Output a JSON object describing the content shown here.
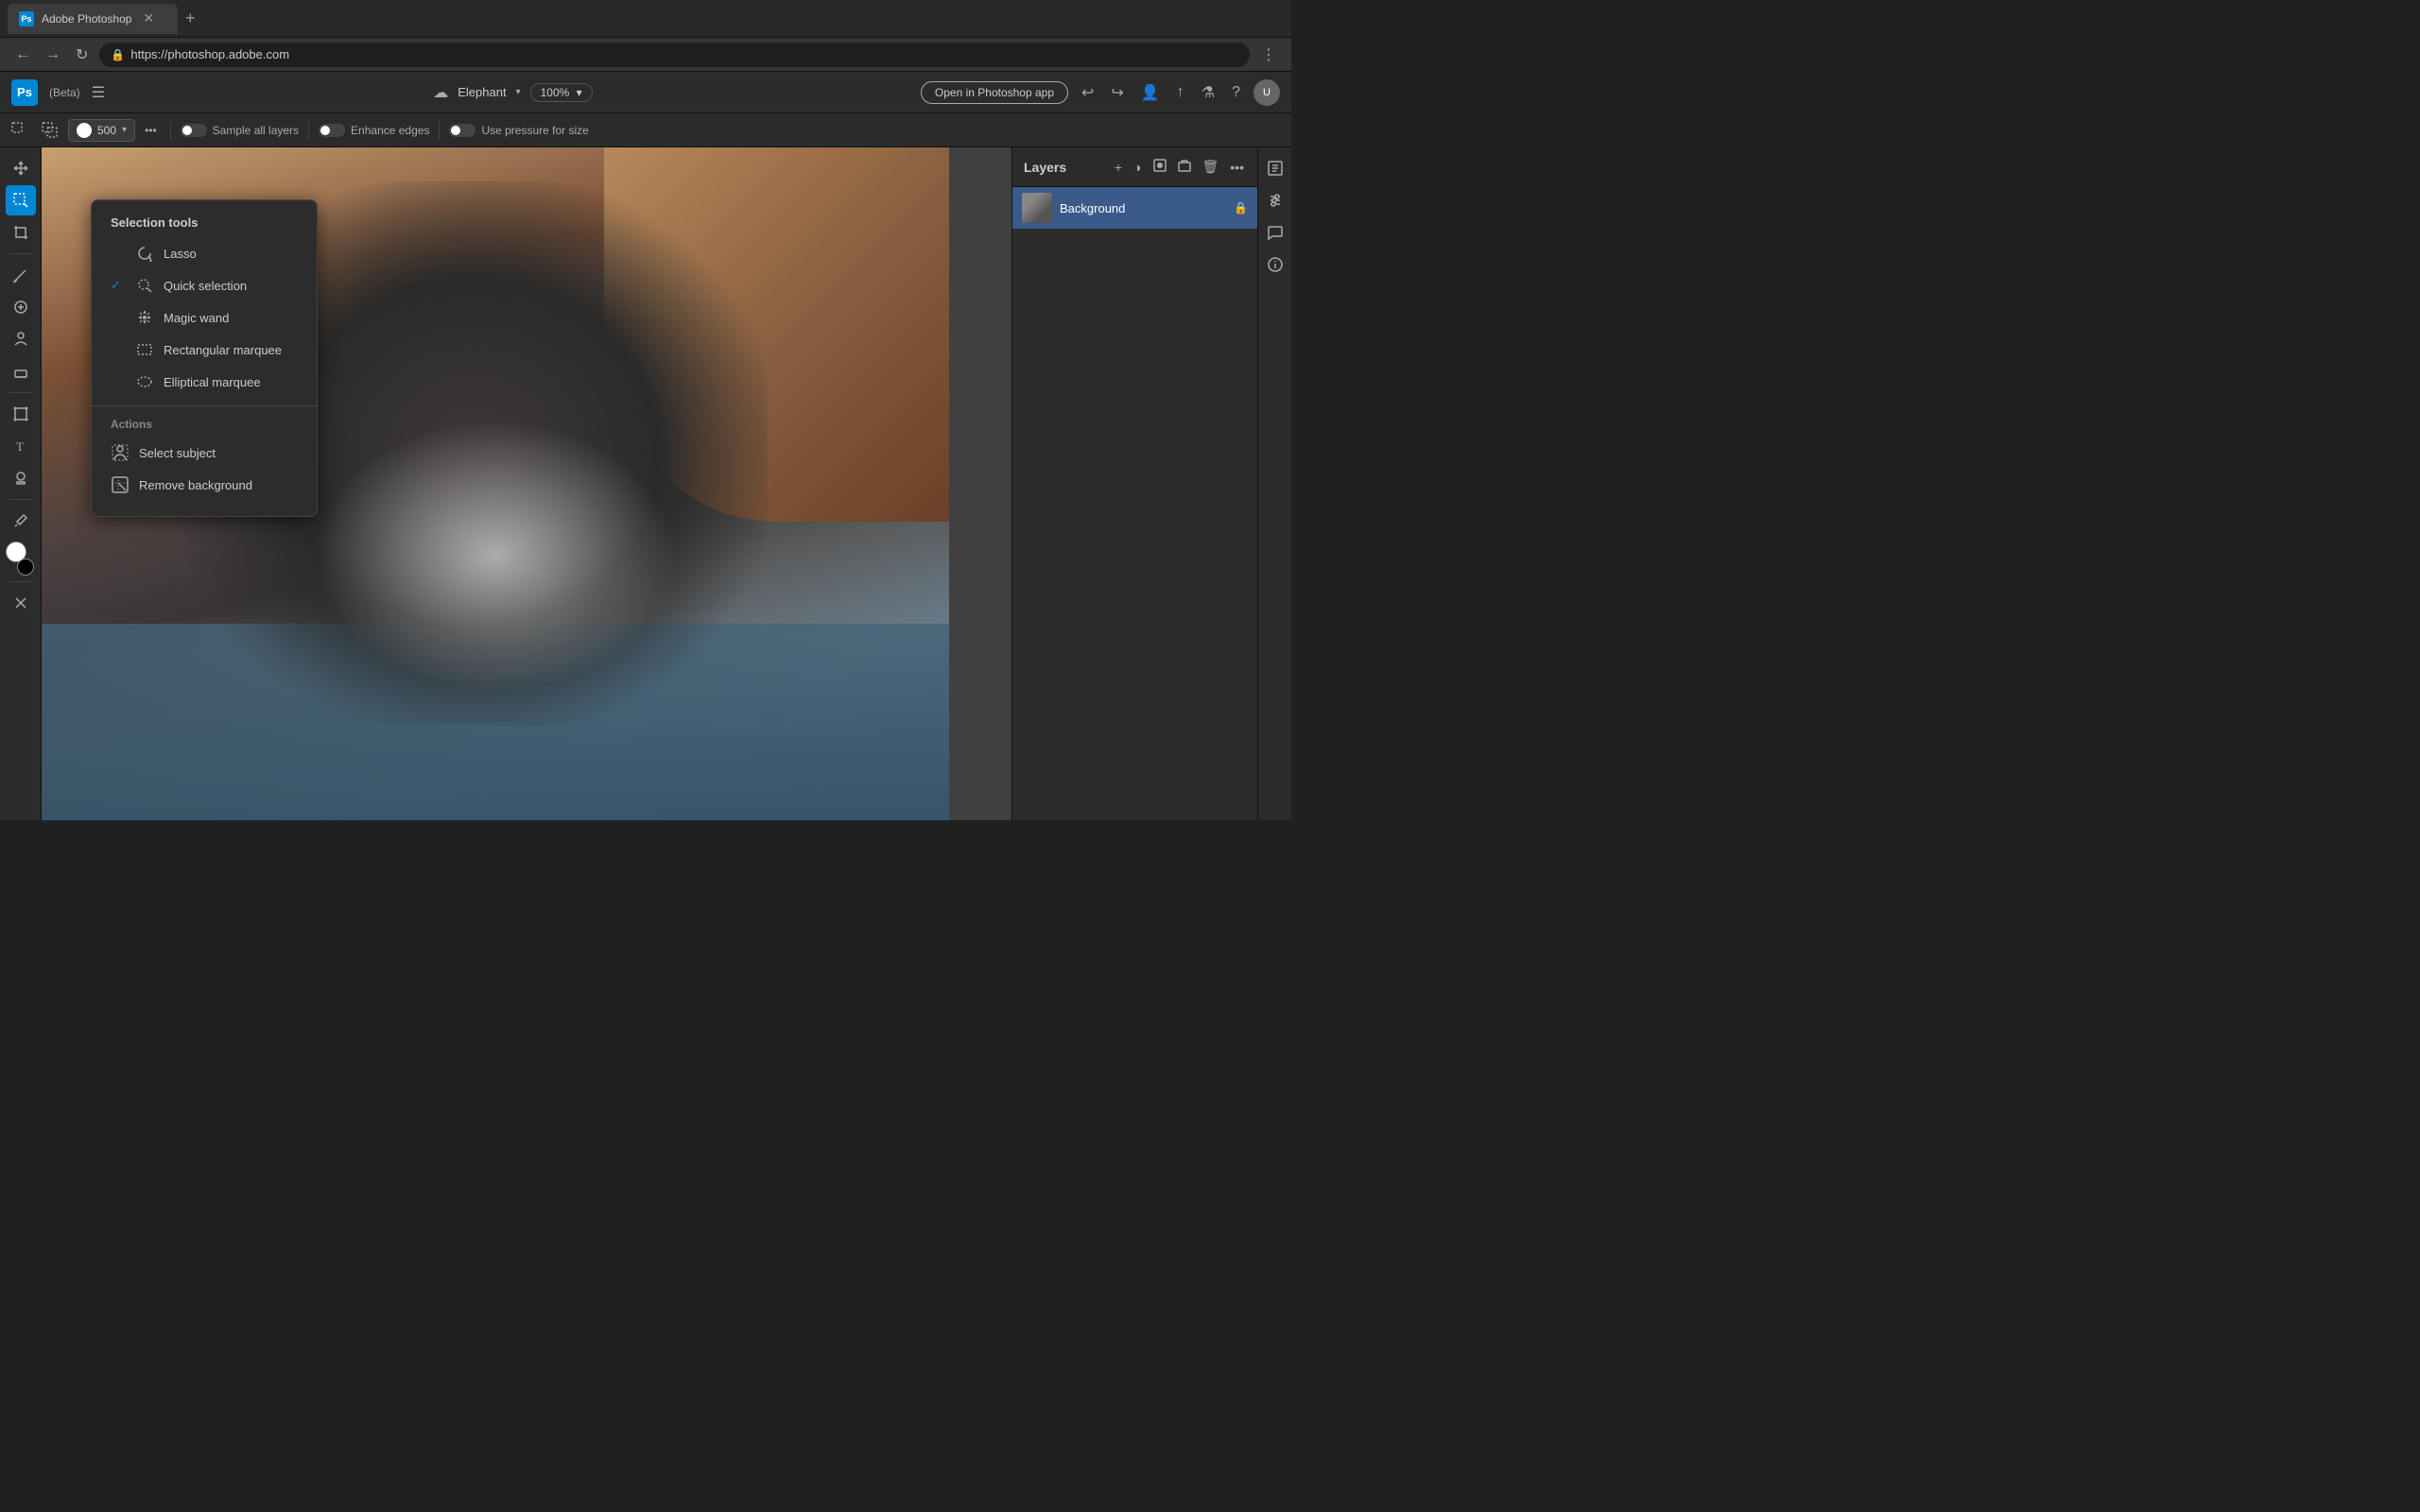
{
  "browser": {
    "tab_title": "Adobe Photoshop",
    "new_tab_label": "+",
    "url": "https://photoshop.adobe.com",
    "nav_back": "←",
    "nav_forward": "→",
    "nav_refresh": "↻",
    "nav_menu": "⋮"
  },
  "app_header": {
    "ps_logo": "Ps",
    "beta_label": "(Beta)",
    "hamburger": "☰",
    "cloud_icon": "☁",
    "file_name": "Elephant",
    "zoom": "100%",
    "open_in_app": "Open in Photoshop app",
    "undo_icon": "↩",
    "redo_icon": "↪"
  },
  "toolbar": {
    "brush_size": "500",
    "sample_all_layers": "Sample all layers",
    "enhance_edges": "Enhance edges",
    "use_pressure": "Use pressure for size"
  },
  "selection_popup": {
    "section_title": "Selection tools",
    "items": [
      {
        "id": "lasso",
        "label": "Lasso",
        "icon": "⊙",
        "checked": false
      },
      {
        "id": "quick-selection",
        "label": "Quick selection",
        "icon": "⊙",
        "checked": true
      },
      {
        "id": "magic-wand",
        "label": "Magic wand",
        "icon": "✦",
        "checked": false
      },
      {
        "id": "rect-marquee",
        "label": "Rectangular marquee",
        "icon": "▭",
        "checked": false
      },
      {
        "id": "ellip-marquee",
        "label": "Elliptical marquee",
        "icon": "◯",
        "checked": false
      }
    ],
    "actions_label": "Actions",
    "actions": [
      {
        "id": "select-subject",
        "label": "Select subject",
        "icon": "👤"
      },
      {
        "id": "remove-bg",
        "label": "Remove background",
        "icon": "🖼"
      }
    ]
  },
  "layers_panel": {
    "title": "Layers",
    "add_icon": "+",
    "adjust_icon": "◑",
    "mask_icon": "□",
    "group_icon": "⊡",
    "delete_icon": "🗑",
    "more_icon": "•••",
    "layer_name": "Background",
    "lock_icon": "🔒"
  }
}
